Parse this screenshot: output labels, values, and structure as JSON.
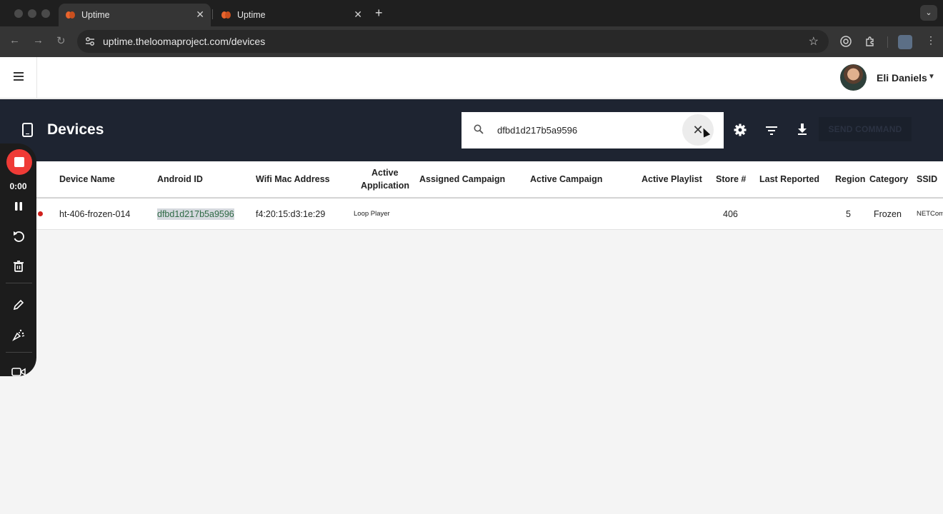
{
  "browser": {
    "tabs": [
      {
        "title": "Uptime",
        "active": true
      },
      {
        "title": "Uptime",
        "active": false
      }
    ],
    "url": "uptime.theloomaproject.com/devices"
  },
  "header": {
    "user_name": "Eli Daniels"
  },
  "page": {
    "title": "Devices",
    "search_value": "dfbd1d217b5a9596",
    "send_command_label": "SEND COMMAND"
  },
  "table": {
    "columns": {
      "device_name": "Device Name",
      "android_id": "Android ID",
      "wifi_mac": "Wifi Mac Address",
      "active_app_line1": "Active",
      "active_app_line2": "Application",
      "assigned_campaign": "Assigned Campaign",
      "active_campaign": "Active Campaign",
      "active_playlist": "Active Playlist",
      "store": "Store #",
      "last_reported": "Last Reported",
      "region": "Region",
      "category": "Category",
      "ssid": "SSID"
    },
    "rows": [
      {
        "device_name": "ht-406-frozen-014",
        "android_id": "dfbd1d217b5a9596",
        "wifi_mac": "f4:20:15:d3:1e:29",
        "active_application": "Loop Player",
        "assigned_campaign": "",
        "active_campaign": "",
        "active_playlist": "",
        "store": "406",
        "last_reported": "",
        "region": "5",
        "category": "Frozen",
        "ssid": "NETCom"
      }
    ]
  },
  "recorder": {
    "time": "0:00"
  },
  "colors": {
    "title_bar": "#1e2431",
    "record_red": "#ef3b36",
    "status_red": "#d0201c"
  }
}
